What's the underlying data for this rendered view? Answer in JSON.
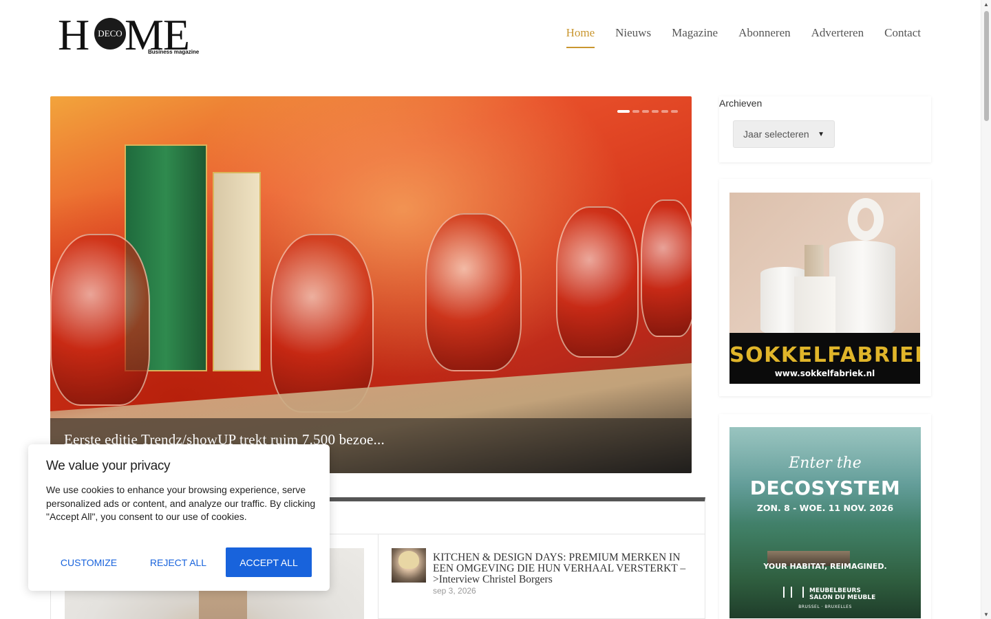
{
  "site": {
    "logo_h": "H",
    "logo_deco": "DECO",
    "logo_me": "ME",
    "logo_sub": "Business magazine"
  },
  "nav": {
    "items": [
      {
        "label": "Home",
        "active": true
      },
      {
        "label": "Nieuws",
        "active": false
      },
      {
        "label": "Magazine",
        "active": false
      },
      {
        "label": "Abonneren",
        "active": false
      },
      {
        "label": "Adverteren",
        "active": false
      },
      {
        "label": "Contact",
        "active": false
      }
    ],
    "active_color": "#c9962f"
  },
  "slider": {
    "caption": "Eerste editie Trendz/showUP trekt ruim 7.500 bezoe...",
    "slide_count": 6,
    "active_slide": 1
  },
  "posts": [
    {
      "title": "KITCHEN & DESIGN DAYS: PREMIUM MERKEN IN EEN OMGEVING DIE HUN VERHAAL VERSTERKT –>Interview Christel Borgers",
      "date": "sep 3, 2026"
    }
  ],
  "sidebar": {
    "archive_title": "Archieven",
    "archive_select": "Jaar selecteren",
    "ad1": {
      "brand": "SOKKELFABRIEK",
      "url": "www.sokkelfabriek.nl"
    },
    "ad2": {
      "enter": "Enter the",
      "title": "DECOSYSTEM",
      "dates": "ZON. 8 - WOE. 11 NOV. 2026",
      "tagline": "YOUR HABITAT, REIMAGINED.",
      "fair_line1": "MEUBELBEURS",
      "fair_line2": "SALON DU MEUBLE",
      "city": "BRUSSEL · BRUXELLES"
    }
  },
  "cookie": {
    "title": "We value your privacy",
    "text": "We use cookies to enhance your browsing experience, serve personalized ads or content, and analyze our traffic. By clicking \"Accept All\", you consent to our use of cookies.",
    "customize": "CUSTOMIZE",
    "reject": "REJECT ALL",
    "accept": "ACCEPT ALL",
    "accent": "#1863dc"
  }
}
